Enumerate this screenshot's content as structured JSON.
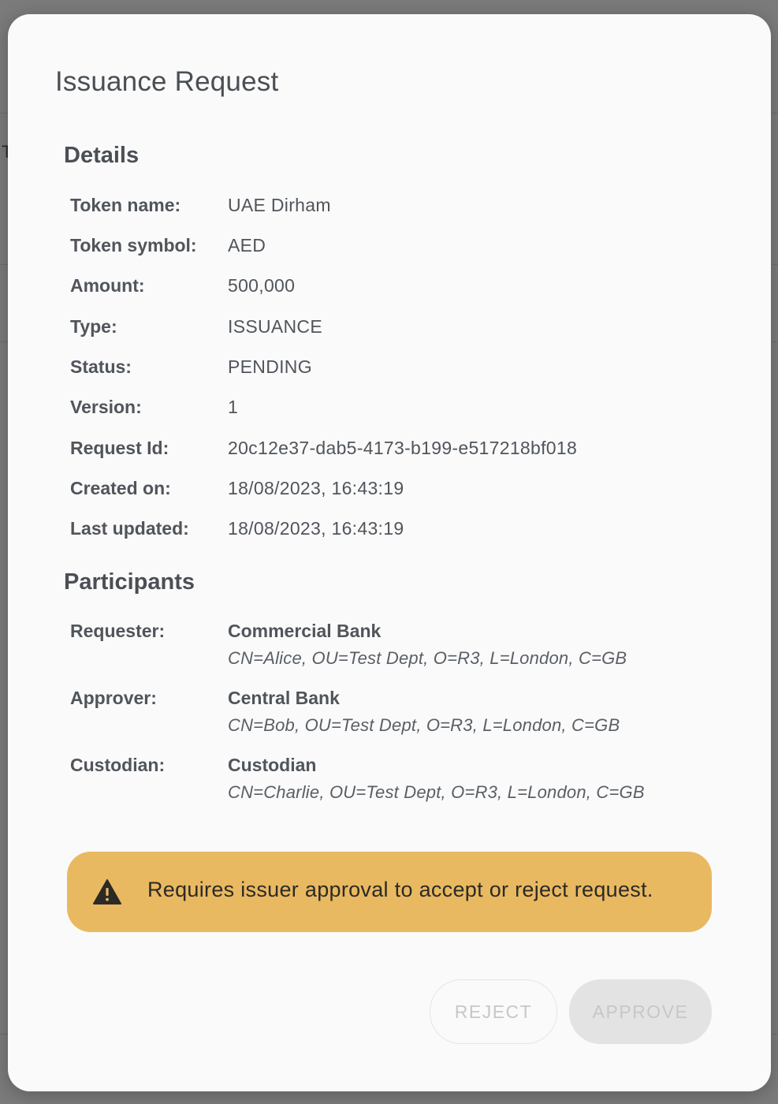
{
  "dialog": {
    "title": "Issuance Request"
  },
  "details": {
    "heading": "Details",
    "rows": [
      {
        "label": "Token name:",
        "value": "UAE Dirham"
      },
      {
        "label": "Token symbol:",
        "value": "AED"
      },
      {
        "label": "Amount:",
        "value": "500,000"
      },
      {
        "label": "Type:",
        "value": "ISSUANCE"
      },
      {
        "label": "Status:",
        "value": "PENDING"
      },
      {
        "label": "Version:",
        "value": "1"
      },
      {
        "label": "Request Id:",
        "value": "20c12e37-dab5-4173-b199-e517218bf018"
      },
      {
        "label": "Created on:",
        "value": "18/08/2023, 16:43:19"
      },
      {
        "label": "Last updated:",
        "value": "18/08/2023, 16:43:19"
      }
    ]
  },
  "participants": {
    "heading": "Participants",
    "rows": [
      {
        "label": "Requester:",
        "name": "Commercial Bank",
        "dn": "CN=Alice, OU=Test Dept, O=R3, L=London, C=GB"
      },
      {
        "label": "Approver:",
        "name": "Central Bank",
        "dn": "CN=Bob, OU=Test Dept, O=R3, L=London, C=GB"
      },
      {
        "label": "Custodian:",
        "name": "Custodian",
        "dn": "CN=Charlie, OU=Test Dept, O=R3, L=London, C=GB"
      }
    ]
  },
  "alert": {
    "icon": "warning-icon",
    "text": "Requires issuer approval to accept or reject request.",
    "color": "#e9b961"
  },
  "actions": {
    "reject_label": "REJECT",
    "approve_label": "APPROVE"
  },
  "background": {
    "partial_text": "T"
  }
}
